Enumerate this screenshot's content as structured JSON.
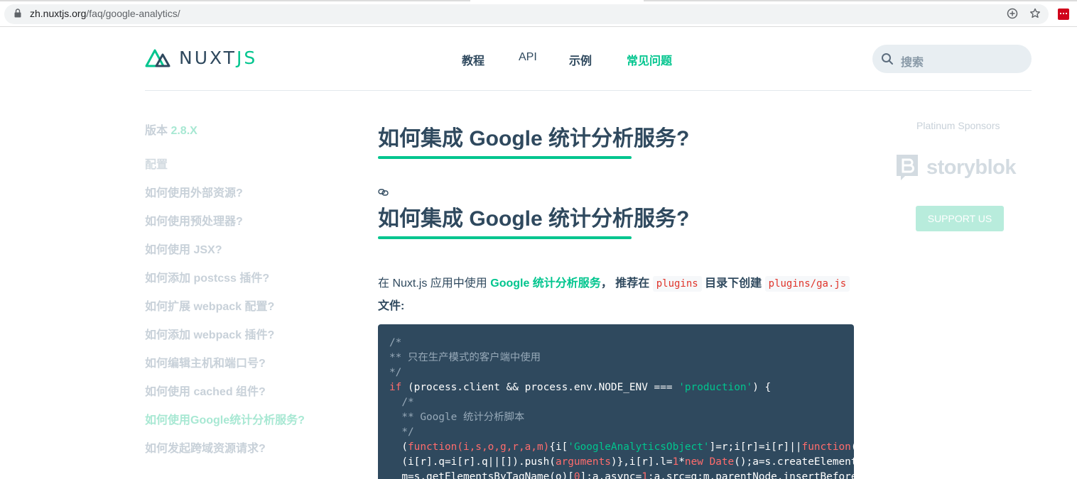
{
  "browser": {
    "url_host": "zh.nuxtjs.org",
    "url_path": "/faq/google-analytics/"
  },
  "header": {
    "logo_text_a": "NUXT",
    "logo_text_b": "JS",
    "nav": [
      {
        "label": "教程"
      },
      {
        "label": "API"
      },
      {
        "label": "示例"
      },
      {
        "label": "常见问题"
      }
    ],
    "search_placeholder": "搜索"
  },
  "sidebar": {
    "version_label": "版本 ",
    "version_value": "2.8.X",
    "section_heading": "配置",
    "items": [
      {
        "label": "如何使用外部资源?"
      },
      {
        "label": "如何使用预处理器?"
      },
      {
        "label": "如何使用 JSX?"
      },
      {
        "label": "如何添加 postcss 插件?"
      },
      {
        "label": "如何扩展 webpack 配置?"
      },
      {
        "label": "如何添加 webpack 插件?"
      },
      {
        "label": "如何编辑主机和端口号?"
      },
      {
        "label": "如何使用 cached 组件?"
      },
      {
        "label": "如何使用Google统计分析服务?"
      },
      {
        "label": "如何发起跨域资源请求?"
      }
    ]
  },
  "main": {
    "page_title": "如何集成 Google 统计分析服务?",
    "section_title": "如何集成 Google 统计分析服务?",
    "para_prefix": "在 Nuxt.js 应用中使用 ",
    "para_link": "Google 统计分析服务",
    "para_mid1": "， 推荐在 ",
    "para_code1": "plugins",
    "para_mid2": " 目录下创建 ",
    "para_code2": "plugins/ga.js",
    "para_suffix": "文件:",
    "code": {
      "l1": "/*",
      "l2": "** 只在生产模式的客户端中使用",
      "l3": "*/",
      "l4_if": "if",
      "l4_a": " (process.client && process.env.NODE_ENV === ",
      "l4_str": "'production'",
      "l4_b": ") {",
      "l5": "  /*",
      "l6": "  ** Google 统计分析脚本",
      "l7": "  */",
      "l8_a": "  (",
      "l8_fn": "function",
      "l8_params": "(i,s,o,g,r,a,m)",
      "l8_b": "{i[",
      "l8_str": "'GoogleAnalyticsObject'",
      "l8_c": "]=r;i[r]=i[r]||",
      "l8_fn2": "function",
      "l8_d": "()",
      "l9_a": "  (i[r].q=i[r].q||[]).push(",
      "l9_args": "arguments",
      "l9_b": ")},i[r].l=",
      "l9_num": "1",
      "l9_c": "*",
      "l9_new": "new",
      "l9_date": " Date",
      "l9_d": "();a=s.createElement(",
      "l10_a": "  m=s.getElementsByTagName(o)[",
      "l10_num": "0",
      "l10_b": "];a.async=",
      "l10_num2": "1",
      "l10_c": ";a.src=g;m.parentNode.insertBefore("
    }
  },
  "sponsors": {
    "heading": "Platinum Sponsors",
    "sponsor_name": "storyblok",
    "support_label": "SUPPORT US"
  }
}
